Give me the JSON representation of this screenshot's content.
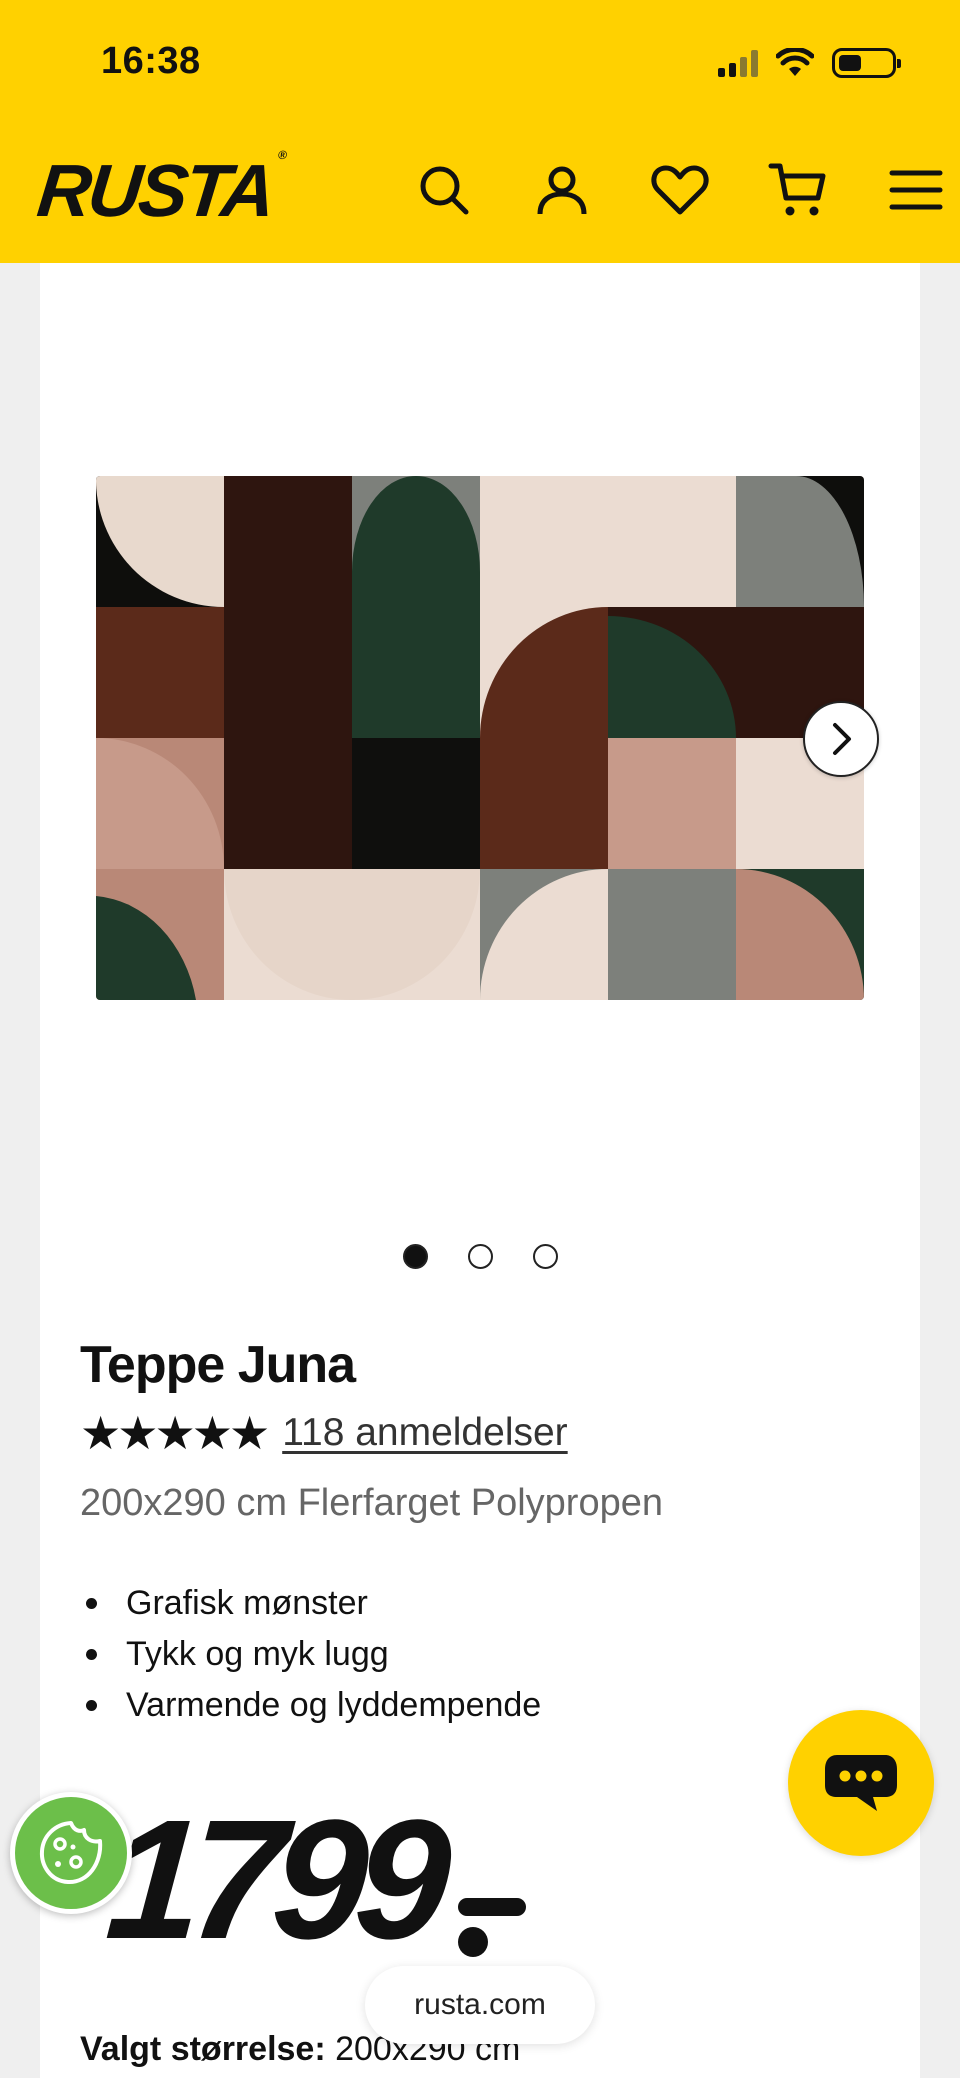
{
  "status_bar": {
    "time": "16:38"
  },
  "header": {
    "logo": "RUSTA",
    "icons": [
      "search-icon",
      "user-icon",
      "heart-icon",
      "cart-icon",
      "menu-icon"
    ],
    "background": "#ffd100"
  },
  "gallery": {
    "image": "rug-image",
    "slide_count": 3,
    "active_slide": 1
  },
  "product": {
    "title": "Teppe Juna",
    "stars": "★★★★★",
    "reviews": "118 anmeldelser",
    "subtitle": "200x290 cm Flerfarget Polypropen",
    "bullets": [
      "Grafisk mønster",
      "Tykk og myk lugg",
      "Varmende og lyddempende"
    ],
    "price": "1799",
    "selected_size_label": "Valgt størrelse:",
    "selected_size_value": "200x290 cm"
  },
  "browser": {
    "url": "rusta.com"
  },
  "colors": {
    "accent": "#ffd100",
    "cookie": "#6cbf4a"
  }
}
